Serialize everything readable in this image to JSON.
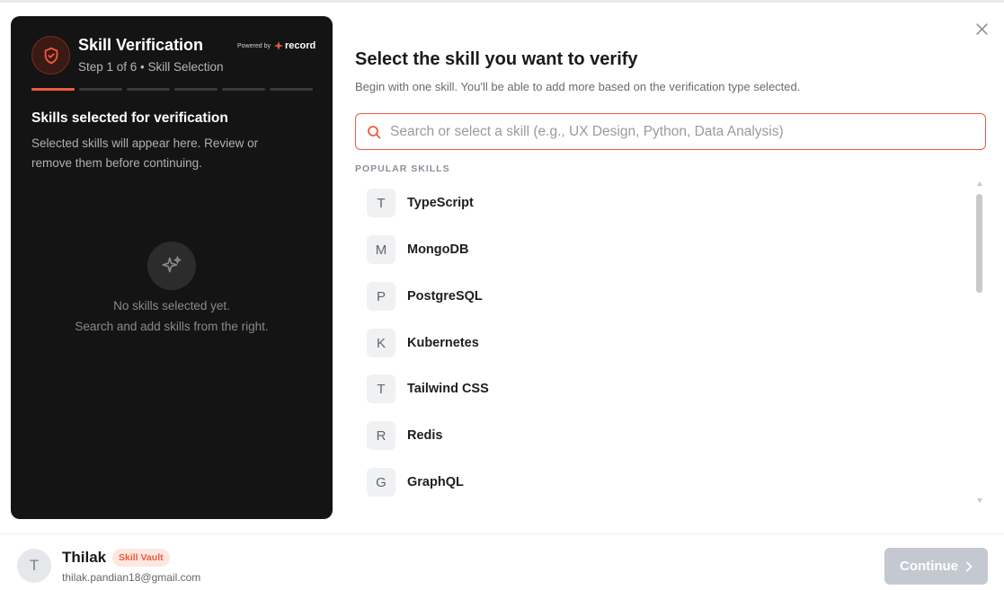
{
  "colors": {
    "accent": "#ef5a3c",
    "panel_bg": "#141414",
    "continue_disabled": "#c4c9d1"
  },
  "panel": {
    "title": "Skill Verification",
    "subtitle": "Step 1 of 6 • Skill Selection",
    "powered_by": "Powered by",
    "brand": "record",
    "icon": "shield-check-icon",
    "steps_total": 6,
    "steps_current": 1,
    "selected_title": "Skills selected for verification",
    "selected_desc": "Selected skills will appear here. Review or remove them before continuing.",
    "empty_icon": "sparkles-icon",
    "empty_line1": "No skills selected yet.",
    "empty_line2": "Search and add skills from the right."
  },
  "main": {
    "title": "Select the skill you want to verify",
    "desc": "Begin with one skill. You'll be able to add more based on the verification type selected.",
    "search_placeholder": "Search or select a skill (e.g., UX Design, Python, Data Analysis)",
    "search_value": "",
    "popular_label": "POPULAR SKILLS",
    "skills": [
      {
        "letter": "T",
        "name": "TypeScript"
      },
      {
        "letter": "M",
        "name": "MongoDB"
      },
      {
        "letter": "P",
        "name": "PostgreSQL"
      },
      {
        "letter": "K",
        "name": "Kubernetes"
      },
      {
        "letter": "T",
        "name": "Tailwind CSS"
      },
      {
        "letter": "R",
        "name": "Redis"
      },
      {
        "letter": "G",
        "name": "GraphQL"
      }
    ]
  },
  "footer": {
    "avatar_letter": "T",
    "name": "Thilak",
    "badge": "Skill Vault",
    "email": "thilak.pandian18@gmail.com",
    "continue_label": "Continue"
  }
}
